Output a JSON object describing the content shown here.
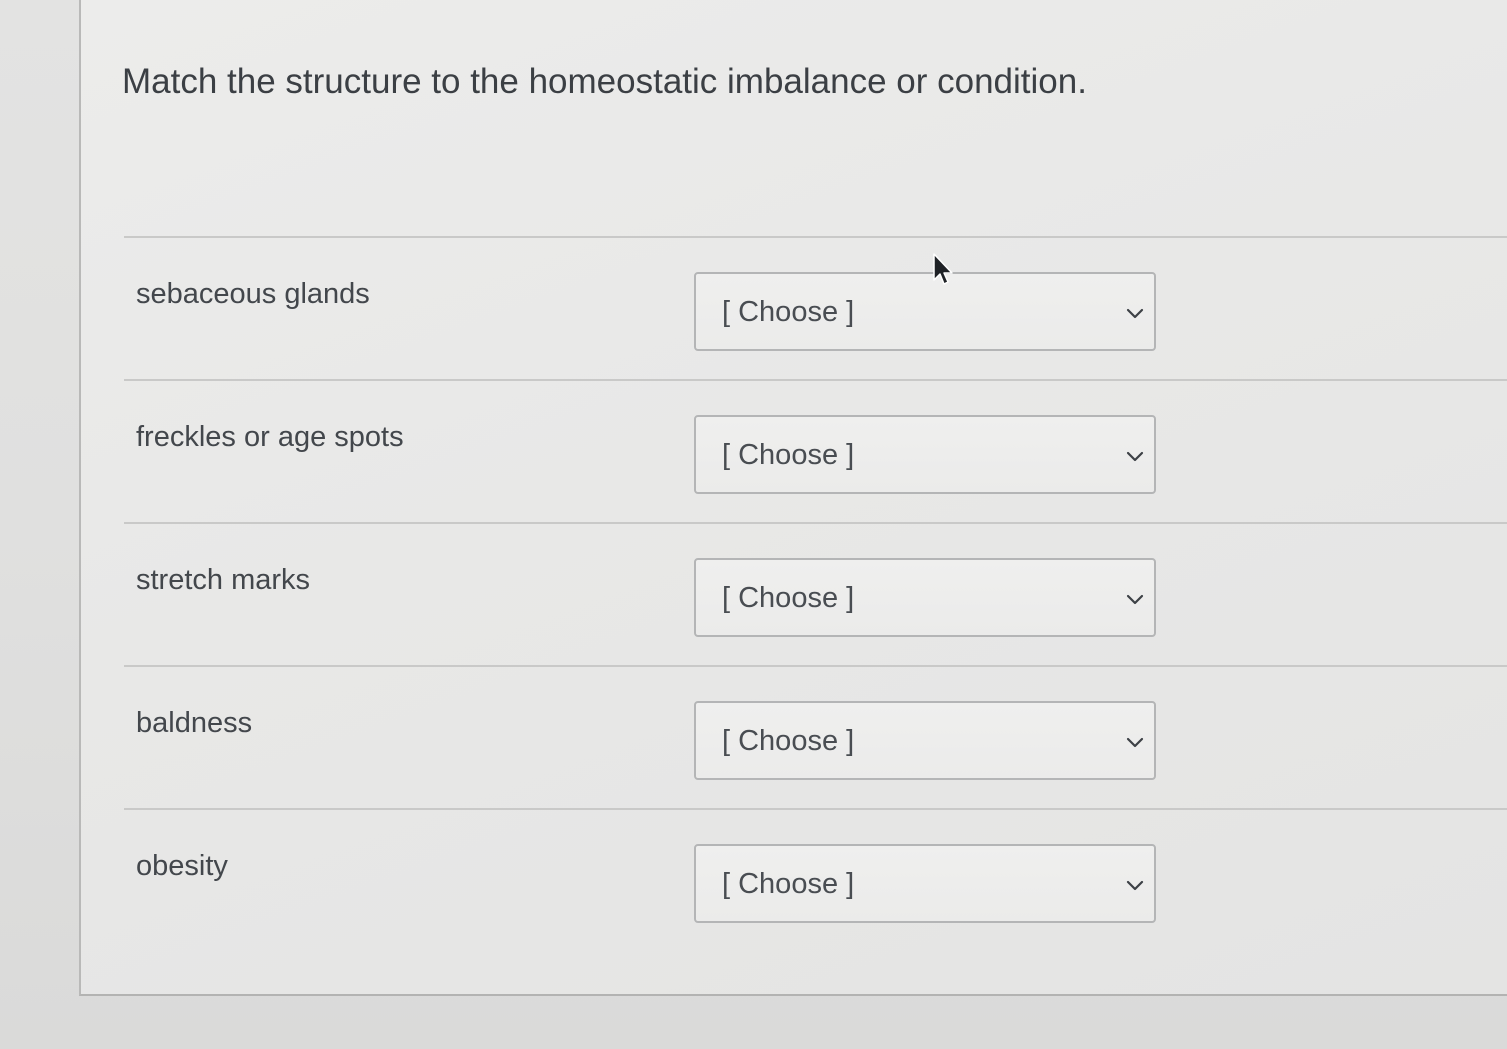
{
  "question": {
    "text": "Match the structure to the homeostatic imbalance or condition."
  },
  "rows": [
    {
      "label": "sebaceous glands",
      "select_value": "[ Choose ]",
      "icon": "chevron-down-icon"
    },
    {
      "label": "freckles or age spots",
      "select_value": "[ Choose ]",
      "icon": "chevron-down-icon"
    },
    {
      "label": "stretch marks",
      "select_value": "[ Choose ]",
      "icon": "chevron-down-icon"
    },
    {
      "label": "baldness",
      "select_value": "[ Choose ]",
      "icon": "chevron-down-icon"
    },
    {
      "label": "obesity",
      "select_value": "[ Choose ]",
      "icon": "chevron-down-icon"
    }
  ],
  "colors": {
    "text": "#3b3f44",
    "border": "#b4b5b6",
    "divider": "#c9c9c8"
  }
}
